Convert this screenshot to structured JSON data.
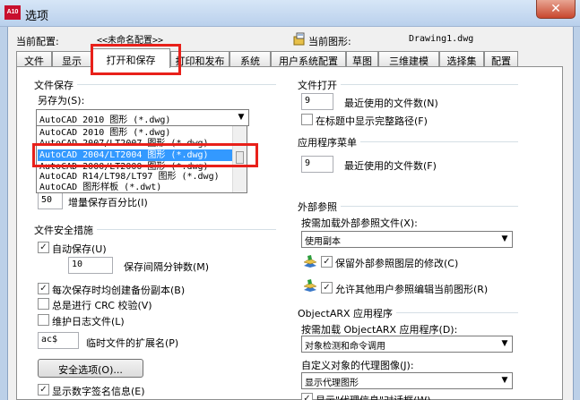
{
  "window": {
    "title": "选项",
    "app_icon": "A10",
    "close_glyph": "✕"
  },
  "header": {
    "profile_label": "当前配置:",
    "profile_value": "<<未命名配置>>",
    "drawing_label": "当前图形:",
    "drawing_value": "Drawing1.dwg"
  },
  "tabs": [
    "文件",
    "显示",
    "打开和保存",
    "打印和发布",
    "系统",
    "用户系统配置",
    "草图",
    "三维建模",
    "选择集",
    "配置"
  ],
  "active_tab": "打开和保存",
  "file_save": {
    "title": "文件保存",
    "save_as_label": "另存为(S):",
    "save_as_value": "AutoCAD 2010 图形 (*.dwg)",
    "dropdown_options": [
      "AutoCAD 2010 图形 (*.dwg)",
      "AutoCAD 2007/LT2007 图形 (*.dwg)",
      "AutoCAD 2004/LT2004 图形 (*.dwg)",
      "AutoCAD 2000/LT2000 图形 (*.dwg)",
      "AutoCAD R14/LT98/LT97 图形 (*.dwg)",
      "AutoCAD 图形样板 (*.dwt)"
    ],
    "highlighted_option": "AutoCAD 2004/LT2004 图形 (*.dwg)",
    "incremental_value": "50",
    "incremental_label": "增量保存百分比(I)"
  },
  "file_safety": {
    "title": "文件安全措施",
    "autosave_label": "自动保存(U)",
    "autosave_checked": true,
    "interval_value": "10",
    "interval_label": "保存间隔分钟数(M)",
    "backup_label": "每次保存时均创建备份副本(B)",
    "backup_checked": true,
    "crc_label": "总是进行 CRC 校验(V)",
    "crc_checked": false,
    "log_label": "维护日志文件(L)",
    "log_checked": false,
    "temp_ext_value": "ac$",
    "temp_ext_label": "临时文件的扩展名(P)",
    "security_button": "安全选项(O)...",
    "digital_sig_label": "显示数字签名信息(E)",
    "digital_sig_checked": true
  },
  "file_open": {
    "title": "文件打开",
    "recent_value": "9",
    "recent_label": "最近使用的文件数(N)",
    "full_path_label": "在标题中显示完整路径(F)",
    "full_path_checked": false
  },
  "app_menu": {
    "title": "应用程序菜单",
    "recent_value": "9",
    "recent_label": "最近使用的文件数(F)"
  },
  "xref": {
    "title": "外部参照",
    "demand_load_label": "按需加载外部参照文件(X):",
    "demand_load_value": "使用副本",
    "retain_label": "保留外部参照图层的修改(C)",
    "retain_checked": true,
    "allow_edit_label": "允许其他用户参照编辑当前图形(R)",
    "allow_edit_checked": true
  },
  "objectarx": {
    "title": "ObjectARX 应用程序",
    "load_label": "按需加载 ObjectARX 应用程序(D):",
    "load_value": "对象检测和命令调用",
    "proxy_label": "自定义对象的代理图像(J):",
    "proxy_value": "显示代理图形",
    "proxy_info_label": "显示\"代理信息\"对话框(W)",
    "proxy_info_checked": true
  },
  "checkmark": "✓",
  "dropdown_arrow": "▼"
}
